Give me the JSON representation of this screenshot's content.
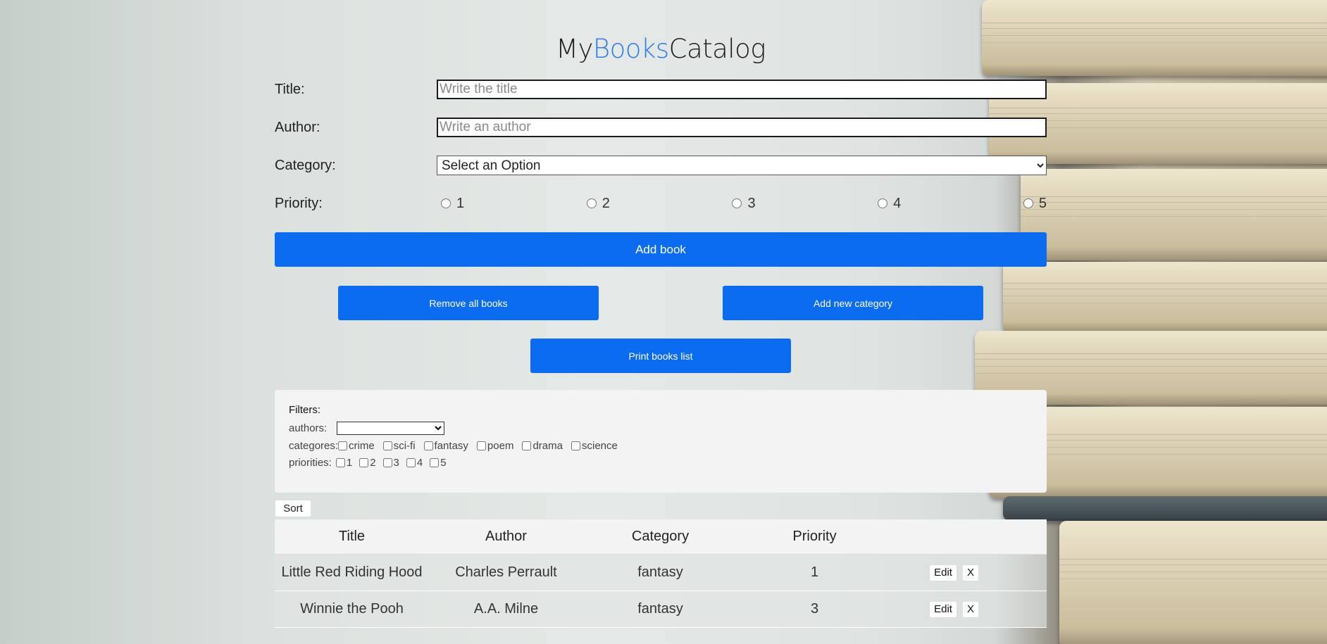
{
  "app": {
    "title_prefix": "My",
    "title_accent": "Books",
    "title_suffix": "Catalog",
    "accent_color": "#2f7be6",
    "button_color": "#0b6cf0"
  },
  "form": {
    "title_label": "Title:",
    "title_placeholder": "Write the title",
    "author_label": "Author:",
    "author_placeholder": "Write an author",
    "category_label": "Category:",
    "category_selected": "Select an Option",
    "priority_label": "Priority:",
    "priorities": [
      "1",
      "2",
      "3",
      "4",
      "5"
    ]
  },
  "buttons": {
    "add_book": "Add book",
    "remove_all": "Remove all books",
    "add_category": "Add new category",
    "print_list": "Print books list",
    "sort": "Sort"
  },
  "filters": {
    "title": "Filters:",
    "authors_label": "authors:",
    "authors_selected": "",
    "categories_label": "categores:",
    "categories": [
      "crime",
      "sci-fi",
      "fantasy",
      "poem",
      "drama",
      "science"
    ],
    "priorities_label": "priorities:",
    "priorities": [
      "1",
      "2",
      "3",
      "4",
      "5"
    ]
  },
  "table": {
    "headers": [
      "Title",
      "Author",
      "Category",
      "Priority"
    ],
    "rows": [
      {
        "title": "Little Red Riding Hood",
        "author": "Charles Perrault",
        "category": "fantasy",
        "priority": "1"
      },
      {
        "title": "Winnie the Pooh",
        "author": "A.A. Milne",
        "category": "fantasy",
        "priority": "3"
      }
    ],
    "edit_label": "Edit",
    "delete_label": "X"
  }
}
